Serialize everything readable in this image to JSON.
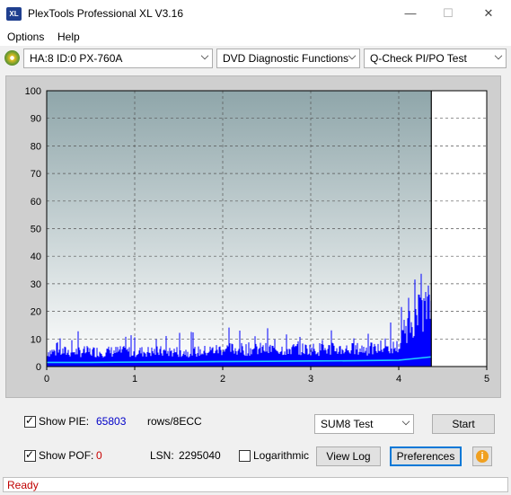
{
  "window": {
    "title": "PlexTools Professional XL V3.16",
    "icon_text": "XL",
    "minimize": "—",
    "maximize": "☐",
    "close": "✕"
  },
  "menu": {
    "options": "Options",
    "help": "Help"
  },
  "toolbar": {
    "drive": "HA:8 ID:0  PX-760A",
    "function": "DVD Diagnostic Functions",
    "test": "Q-Check PI/PO Test"
  },
  "chart_data": {
    "type": "area",
    "xlim": [
      0,
      5
    ],
    "ylim": [
      0,
      100
    ],
    "x_ticks": [
      "0",
      "1",
      "2",
      "3",
      "4",
      "5"
    ],
    "y_ticks": [
      "0",
      "10",
      "20",
      "30",
      "40",
      "50",
      "60",
      "70",
      "80",
      "90",
      "100"
    ],
    "grid": true,
    "end_marker_x": 4.37,
    "series": [
      {
        "color": "#0000ff",
        "style": "bars",
        "x": [
          0,
          0.25,
          0.5,
          0.75,
          1.0,
          1.25,
          1.5,
          1.75,
          2.0,
          2.25,
          2.5,
          2.75,
          3.0,
          3.25,
          3.5,
          3.75,
          4.0,
          4.05,
          4.1,
          4.15,
          4.2,
          4.25,
          4.3,
          4.37
        ],
        "y": [
          6,
          6,
          6,
          6,
          6,
          6,
          6,
          6,
          7,
          7,
          7,
          7,
          7,
          7,
          7,
          7,
          8,
          12,
          16,
          18,
          20,
          22,
          23,
          25
        ]
      },
      {
        "color": "#20d0ff",
        "style": "line",
        "x": [
          0,
          0.5,
          1.0,
          1.5,
          2.0,
          2.5,
          3.0,
          3.5,
          4.0,
          4.37
        ],
        "y": [
          1.5,
          1.5,
          1.6,
          1.7,
          1.8,
          1.9,
          2.0,
          2.1,
          2.3,
          3.5
        ]
      }
    ]
  },
  "controls": {
    "show_pie_label": "Show PIE:",
    "pie_value": "65803",
    "unit_label": "rows/8ECC",
    "show_pof_label": "Show POF:",
    "pof_value": "0",
    "lsn_label": "LSN:",
    "lsn_value": "2295040",
    "logarithmic_label": "Logarithmic",
    "test_select": "SUM8 Test",
    "start": "Start",
    "view_log": "View Log",
    "preferences": "Preferences",
    "info_icon": "i"
  },
  "status": {
    "text": "Ready"
  }
}
